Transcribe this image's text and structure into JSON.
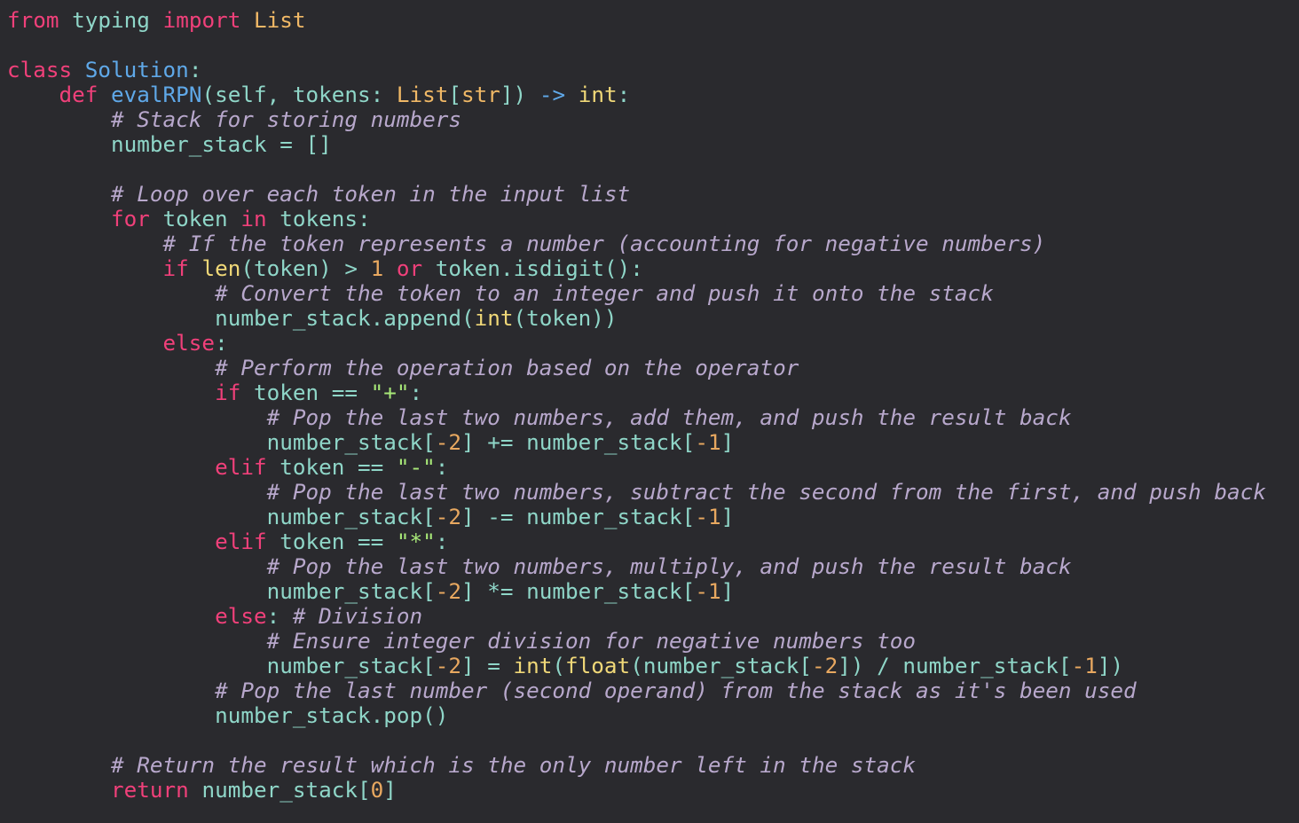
{
  "editor": {
    "language": "python",
    "colors": {
      "background": "#2a2a2e",
      "keyword": "#f0407a",
      "identifier": "#8fd6c8",
      "type": "#f0b866",
      "class_name": "#5fa8e8",
      "number": "#e8a860",
      "string": "#a8e878",
      "builtin": "#f0d878",
      "comment": "#b8a8cc"
    },
    "lines": [
      [
        [
          "kw",
          "from"
        ],
        [
          "t",
          " "
        ],
        [
          "id",
          "typing"
        ],
        [
          "t",
          " "
        ],
        [
          "kw",
          "import"
        ],
        [
          "t",
          " "
        ],
        [
          "typ",
          "List"
        ]
      ],
      [],
      [
        [
          "kw",
          "class"
        ],
        [
          "t",
          " "
        ],
        [
          "cls",
          "Solution"
        ],
        [
          "id",
          ":"
        ]
      ],
      [
        [
          "t",
          "    "
        ],
        [
          "kw",
          "def"
        ],
        [
          "t",
          " "
        ],
        [
          "fn",
          "evalRPN"
        ],
        [
          "id",
          "(self, tokens: "
        ],
        [
          "typ",
          "List"
        ],
        [
          "id",
          "["
        ],
        [
          "typ",
          "str"
        ],
        [
          "id",
          "]) "
        ],
        [
          "op",
          "->"
        ],
        [
          "t",
          " "
        ],
        [
          "bi",
          "int"
        ],
        [
          "id",
          ":"
        ]
      ],
      [
        [
          "t",
          "        "
        ],
        [
          "cm",
          "# Stack for storing numbers"
        ]
      ],
      [
        [
          "t",
          "        "
        ],
        [
          "id",
          "number_stack = []"
        ]
      ],
      [],
      [
        [
          "t",
          "        "
        ],
        [
          "cm",
          "# Loop over each token in the input list"
        ]
      ],
      [
        [
          "t",
          "        "
        ],
        [
          "kw",
          "for"
        ],
        [
          "id",
          " token "
        ],
        [
          "kw",
          "in"
        ],
        [
          "id",
          " tokens:"
        ]
      ],
      [
        [
          "t",
          "            "
        ],
        [
          "cm",
          "# If the token represents a number (accounting for negative numbers)"
        ]
      ],
      [
        [
          "t",
          "            "
        ],
        [
          "kw",
          "if"
        ],
        [
          "t",
          " "
        ],
        [
          "bi",
          "len"
        ],
        [
          "id",
          "(token) > "
        ],
        [
          "num",
          "1"
        ],
        [
          "t",
          " "
        ],
        [
          "kw",
          "or"
        ],
        [
          "id",
          " token.isdigit():"
        ]
      ],
      [
        [
          "t",
          "                "
        ],
        [
          "cm",
          "# Convert the token to an integer and push it onto the stack"
        ]
      ],
      [
        [
          "t",
          "                "
        ],
        [
          "id",
          "number_stack.append("
        ],
        [
          "bi",
          "int"
        ],
        [
          "id",
          "(token))"
        ]
      ],
      [
        [
          "t",
          "            "
        ],
        [
          "kw",
          "else"
        ],
        [
          "id",
          ":"
        ]
      ],
      [
        [
          "t",
          "                "
        ],
        [
          "cm",
          "# Perform the operation based on the operator"
        ]
      ],
      [
        [
          "t",
          "                "
        ],
        [
          "kw",
          "if"
        ],
        [
          "id",
          " token == "
        ],
        [
          "str",
          "\"+\""
        ],
        [
          "id",
          ":"
        ]
      ],
      [
        [
          "t",
          "                    "
        ],
        [
          "cm",
          "# Pop the last two numbers, add them, and push the result back"
        ]
      ],
      [
        [
          "t",
          "                    "
        ],
        [
          "id",
          "number_stack["
        ],
        [
          "num",
          "-2"
        ],
        [
          "id",
          "] += number_stack["
        ],
        [
          "num",
          "-1"
        ],
        [
          "id",
          "]"
        ]
      ],
      [
        [
          "t",
          "                "
        ],
        [
          "kw",
          "elif"
        ],
        [
          "id",
          " token == "
        ],
        [
          "str",
          "\"-\""
        ],
        [
          "id",
          ":"
        ]
      ],
      [
        [
          "t",
          "                    "
        ],
        [
          "cm",
          "# Pop the last two numbers, subtract the second from the first, and push back"
        ]
      ],
      [
        [
          "t",
          "                    "
        ],
        [
          "id",
          "number_stack["
        ],
        [
          "num",
          "-2"
        ],
        [
          "id",
          "] -= number_stack["
        ],
        [
          "num",
          "-1"
        ],
        [
          "id",
          "]"
        ]
      ],
      [
        [
          "t",
          "                "
        ],
        [
          "kw",
          "elif"
        ],
        [
          "id",
          " token == "
        ],
        [
          "str",
          "\"*\""
        ],
        [
          "id",
          ":"
        ]
      ],
      [
        [
          "t",
          "                    "
        ],
        [
          "cm",
          "# Pop the last two numbers, multiply, and push the result back"
        ]
      ],
      [
        [
          "t",
          "                    "
        ],
        [
          "id",
          "number_stack["
        ],
        [
          "num",
          "-2"
        ],
        [
          "id",
          "] *= number_stack["
        ],
        [
          "num",
          "-1"
        ],
        [
          "id",
          "]"
        ]
      ],
      [
        [
          "t",
          "                "
        ],
        [
          "kw",
          "else"
        ],
        [
          "id",
          ": "
        ],
        [
          "cm",
          "# Division"
        ]
      ],
      [
        [
          "t",
          "                    "
        ],
        [
          "cm",
          "# Ensure integer division for negative numbers too"
        ]
      ],
      [
        [
          "t",
          "                    "
        ],
        [
          "id",
          "number_stack["
        ],
        [
          "num",
          "-2"
        ],
        [
          "id",
          "] = "
        ],
        [
          "bi",
          "int"
        ],
        [
          "id",
          "("
        ],
        [
          "bi",
          "float"
        ],
        [
          "id",
          "(number_stack["
        ],
        [
          "num",
          "-2"
        ],
        [
          "id",
          "]) / number_stack["
        ],
        [
          "num",
          "-1"
        ],
        [
          "id",
          "])"
        ]
      ],
      [
        [
          "t",
          "                "
        ],
        [
          "cm",
          "# Pop the last number (second operand) from the stack as it's been used"
        ]
      ],
      [
        [
          "t",
          "                "
        ],
        [
          "id",
          "number_stack.pop()"
        ]
      ],
      [],
      [
        [
          "t",
          "        "
        ],
        [
          "cm",
          "# Return the result which is the only number left in the stack"
        ]
      ],
      [
        [
          "t",
          "        "
        ],
        [
          "kw",
          "return"
        ],
        [
          "id",
          " number_stack["
        ],
        [
          "num",
          "0"
        ],
        [
          "id",
          "]"
        ]
      ]
    ]
  }
}
